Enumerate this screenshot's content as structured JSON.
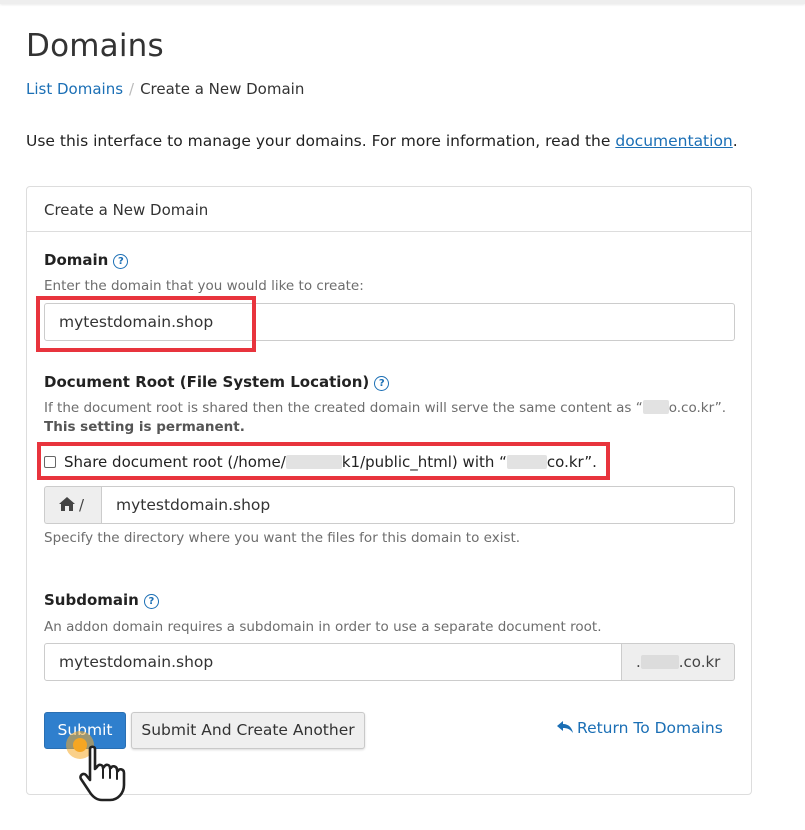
{
  "header": {
    "title": "Domains"
  },
  "breadcrumb": {
    "link": "List Domains",
    "separator": "/",
    "current": "Create a New Domain"
  },
  "intro": {
    "text": "Use this interface to manage your domains. For more information, read the ",
    "link": "documentation",
    "trailing": "."
  },
  "panel": {
    "title": "Create a New Domain"
  },
  "domain_field": {
    "label": "Domain",
    "hint": "Enter the domain that you would like to create:",
    "value": "mytestdomain.shop"
  },
  "docroot": {
    "label": "Document Root (File System Location)",
    "hint_before": "If the document root is shared then the created domain will serve the same content as “",
    "hint_after": "o.co.kr”.",
    "warning": "This setting is permanent.",
    "share_before": "Share document root (/home/",
    "share_middle": "k1/public_html) with “",
    "share_after": "co.kr”.",
    "share_checked": false,
    "prefix": "/",
    "value": "mytestdomain.shop",
    "help": "Specify the directory where you want the files for this domain to exist."
  },
  "subdomain": {
    "label": "Subdomain",
    "hint": "An addon domain requires a subdomain in order to use a separate document root.",
    "value": "mytestdomain.shop",
    "suffix_dot": ".",
    "suffix_tail": ".co.kr"
  },
  "actions": {
    "submit": "Submit",
    "submit_another": "Submit And Create Another",
    "return": "Return To Domains"
  },
  "icons": {
    "help": "question-circle-icon",
    "home": "home-icon",
    "return": "reply-arrow-icon",
    "cursor": "pointing-hand-cursor-icon"
  },
  "colors": {
    "link": "#1b6fb5",
    "primary": "#2f7fcd",
    "highlight": "#e8343d",
    "click_marker": "#f5a623"
  }
}
